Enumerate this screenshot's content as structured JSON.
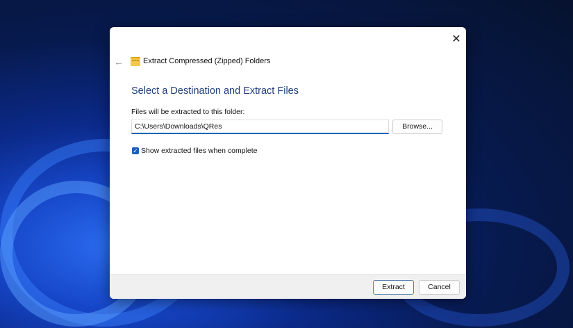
{
  "window": {
    "title": "Extract Compressed (Zipped) Folders",
    "close_icon": "close-icon",
    "back_icon": "back-arrow-icon"
  },
  "main": {
    "heading": "Select a Destination and Extract Files",
    "destination_label": "Files will be extracted to this folder:",
    "destination_value": "C:\\Users\\Downloads\\QRes",
    "browse_label": "Browse...",
    "show_files_label": "Show extracted files when complete",
    "show_files_checked": true
  },
  "footer": {
    "extract_label": "Extract",
    "cancel_label": "Cancel"
  }
}
